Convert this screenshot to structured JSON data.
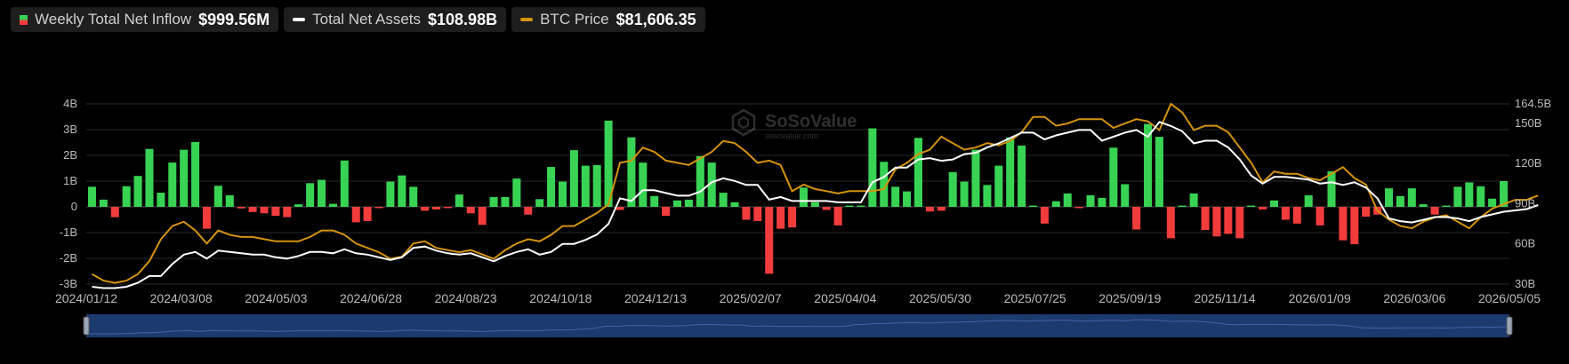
{
  "legend": {
    "inflow_label": "Weekly Total Net Inflow",
    "inflow_value": "$999.56M",
    "assets_label": "Total Net Assets",
    "assets_value": "$108.98B",
    "price_label": "BTC Price",
    "price_value": "$81,606.35"
  },
  "watermark": "SoSoValue",
  "watermark_sub": "sosovalue.com",
  "colors": {
    "positive": "#39d353",
    "negative": "#f23c3c",
    "assets_line": "#ffffff",
    "price_line": "#d4930d",
    "navigator": "#1d3a6e"
  },
  "chart_data": {
    "type": "bar",
    "x_ticks": [
      "2024/01/12",
      "2024/03/08",
      "2024/05/03",
      "2024/06/28",
      "2024/08/23",
      "2024/10/18",
      "2024/12/13",
      "2025/02/07",
      "2025/04/04",
      "2025/05/30",
      "2025/07/25",
      "2025/09/19",
      "2025/11/14",
      "2026/01/09",
      "2026/03/06",
      "2026/05/05"
    ],
    "y_left_ticks": [
      "4B",
      "3B",
      "2B",
      "1B",
      "0",
      "-1B",
      "-2B",
      "-3B"
    ],
    "y_left_range": [
      -3,
      4
    ],
    "y_right_ticks": [
      "164.5B",
      "150B",
      "120B",
      "90B",
      "60B",
      "30B"
    ],
    "y_right_range": [
      30,
      164.5
    ],
    "grid": true,
    "series": [
      {
        "name": "Weekly Total Net Inflow",
        "unit": "B USD",
        "values": [
          0.78,
          0.28,
          -0.4,
          0.8,
          1.2,
          2.25,
          0.55,
          1.72,
          2.22,
          2.52,
          -0.85,
          0.82,
          0.45,
          -0.06,
          -0.2,
          -0.25,
          -0.35,
          -0.4,
          0.1,
          0.92,
          1.05,
          0.12,
          1.8,
          -0.6,
          -0.55,
          -0.05,
          0.98,
          1.22,
          0.78,
          -0.15,
          -0.1,
          -0.05,
          0.48,
          -0.25,
          -0.7,
          0.38,
          0.38,
          1.1,
          -0.3,
          0.3,
          1.55,
          0.98,
          2.2,
          1.6,
          1.62,
          3.35,
          -0.12,
          2.7,
          1.72,
          0.42,
          -0.35,
          0.25,
          0.28,
          1.97,
          1.72,
          0.55,
          0.18,
          -0.5,
          -0.55,
          -2.6,
          -0.85,
          -0.8,
          0.75,
          0.18,
          -0.12,
          -0.72,
          0.05,
          0.05,
          3.05,
          1.75,
          0.78,
          0.6,
          2.68,
          -0.18,
          -0.15,
          1.35,
          0.98,
          2.22,
          0.85,
          1.6,
          2.7,
          2.38,
          0.05,
          -0.65,
          0.22,
          0.52,
          -0.05,
          0.45,
          0.35,
          2.3,
          0.88,
          -0.88,
          3.22,
          2.72,
          -1.22,
          0.05,
          0.52,
          -0.9,
          -1.15,
          -1.05,
          -1.22,
          0.05,
          -0.1,
          0.25,
          -0.5,
          -0.65,
          0.45,
          -0.72,
          1.38,
          -1.3,
          -1.45,
          -0.38,
          -0.3,
          0.72,
          0.42,
          0.72,
          0.1,
          -0.3,
          0.05,
          0.78,
          0.95,
          0.8,
          0.32,
          1.0
        ]
      },
      {
        "name": "Total Net Assets",
        "unit": "B USD",
        "values": [
          28,
          27,
          27,
          28,
          31,
          36,
          36,
          45,
          52,
          54,
          49,
          55,
          54,
          53,
          52,
          52,
          50,
          49,
          51,
          54,
          54,
          53,
          56,
          53,
          52,
          50,
          48,
          50,
          57,
          58,
          55,
          53,
          52,
          53,
          50,
          47,
          51,
          54,
          56,
          52,
          54,
          60,
          60,
          63,
          67,
          75,
          94,
          92,
          100,
          100,
          98,
          96,
          96,
          99,
          106,
          109,
          107,
          104,
          104,
          93,
          95,
          92,
          92,
          92,
          92,
          91,
          91,
          91,
          106,
          110,
          117,
          117,
          123,
          124,
          122,
          123,
          127,
          128,
          132,
          135,
          139,
          143,
          143,
          138,
          141,
          143,
          145,
          145,
          137,
          140,
          143,
          145,
          140,
          151,
          148,
          144,
          135,
          137,
          137,
          132,
          123,
          111,
          105,
          110,
          110,
          109,
          108,
          105,
          106,
          104,
          106,
          102,
          94,
          79,
          77,
          76,
          78,
          80,
          80,
          79,
          77,
          80,
          82,
          84,
          85,
          86,
          89
        ]
      },
      {
        "name": "BTC Price",
        "unit": "K USD",
        "values": [
          46,
          43,
          42,
          43,
          46,
          52,
          62,
          68,
          70,
          66,
          60,
          66,
          64,
          63,
          63,
          62,
          61,
          61,
          61,
          63,
          66,
          66,
          64,
          60,
          58,
          56,
          53,
          54,
          60,
          61,
          58,
          57,
          56,
          57,
          55,
          53,
          57,
          60,
          62,
          61,
          64,
          68,
          68,
          71,
          74,
          78,
          97,
          98,
          104,
          102,
          98,
          97,
          96,
          99,
          102,
          107,
          106,
          102,
          97,
          98,
          96,
          84,
          87,
          85,
          84,
          83,
          84,
          84,
          84,
          85,
          94,
          97,
          101,
          103,
          109,
          106,
          103,
          104,
          106,
          105,
          107,
          111,
          118,
          118,
          114,
          115,
          117,
          117,
          117,
          113,
          115,
          117,
          116,
          112,
          124,
          120,
          112,
          114,
          114,
          111,
          104,
          97,
          88,
          93,
          92,
          92,
          90,
          89,
          92,
          95,
          90,
          87,
          75,
          71,
          68,
          67,
          70,
          72,
          73,
          70,
          67,
          72,
          76,
          78,
          80,
          80,
          82
        ]
      }
    ],
    "legend_position": "top-left"
  }
}
